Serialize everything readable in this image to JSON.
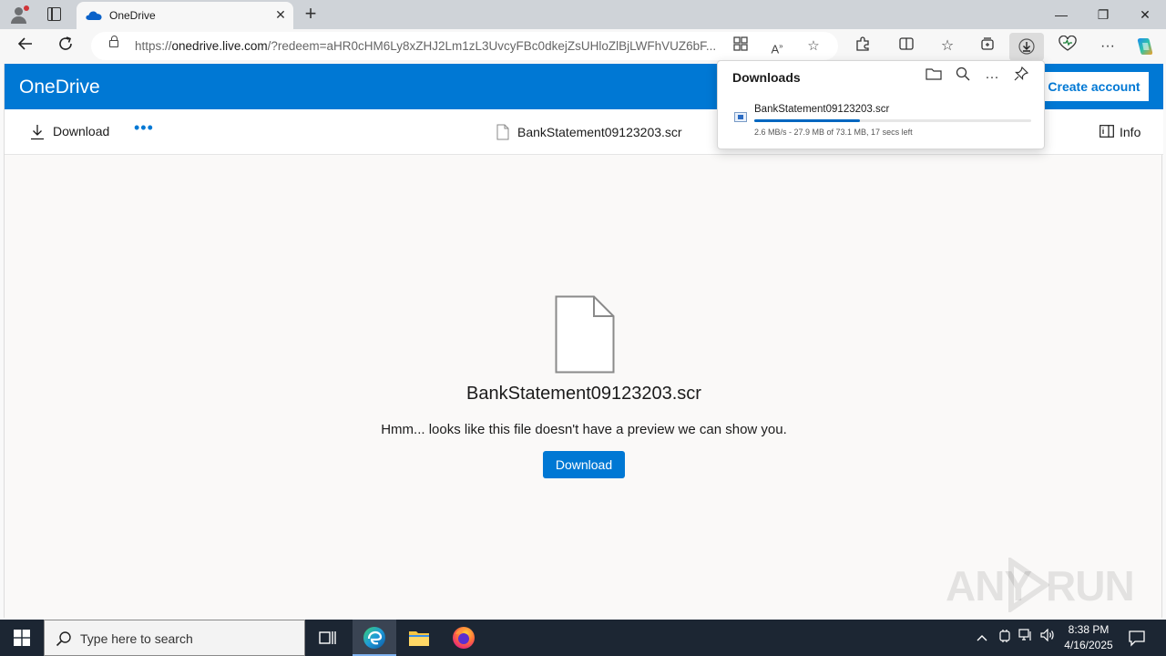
{
  "browser": {
    "tab": {
      "title": "OneDrive",
      "close": "✕"
    },
    "new_tab": "+",
    "window_controls": {
      "minimize": "—",
      "maximize": "❐",
      "close": "✕"
    },
    "address": {
      "url_prefix": "https://",
      "url_host": "onedrive.live.com",
      "url_rest": "/?redeem=aHR0cHM6Ly8xZHJ2Lm1zL3UvcyFBc0dkejZsUHloZlBjLWFhVUZ6bF..."
    },
    "icons": [
      "back-icon",
      "refresh-icon",
      "lock-icon",
      "apps-icon",
      "read-aloud-icon",
      "favorite-star-icon",
      "extensions-icon",
      "split-screen-icon",
      "favorites-icon",
      "collections-icon",
      "downloads-icon",
      "browser-essentials-icon",
      "more-icon",
      "copilot-icon"
    ]
  },
  "onedrive": {
    "brand": "OneDrive",
    "create_account": "Create account",
    "command_bar": {
      "download_label": "Download",
      "more": "•••",
      "file_name": "BankStatement09123203.scr",
      "info_label": "Info"
    },
    "preview": {
      "file_name": "BankStatement09123203.scr",
      "message": "Hmm... looks like this file doesn't have a preview we can show you.",
      "download_button": "Download"
    },
    "colors": {
      "brand_blue": "#0078d4"
    }
  },
  "downloads_panel": {
    "title": "Downloads",
    "item": {
      "file_name": "BankStatement09123203.scr",
      "status": "2.6 MB/s - 27.9 MB of 73.1 MB, 17 secs left",
      "progress_fraction": 0.38
    }
  },
  "watermark": {
    "left": "ANY",
    "right": "RUN"
  },
  "taskbar": {
    "search_placeholder": "Type here to search",
    "clock": {
      "time": "8:38 PM",
      "date": "4/16/2025"
    }
  }
}
